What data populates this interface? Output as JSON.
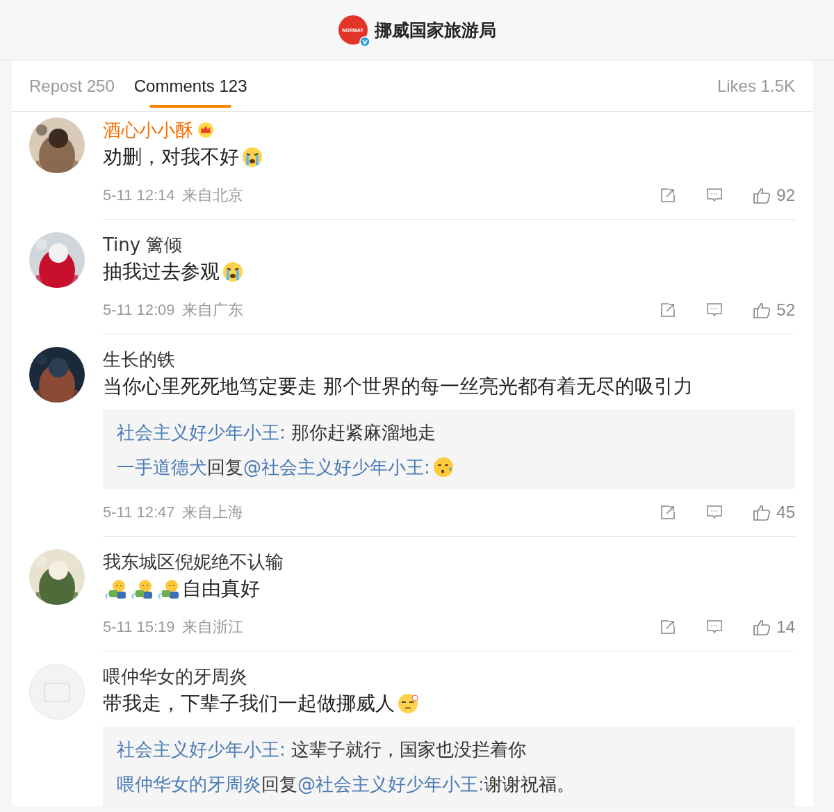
{
  "header": {
    "logo_text": "NORWAY",
    "title": "挪威国家旅游局",
    "verified": true
  },
  "tabs": [
    {
      "label": "Repost 250",
      "selected": false
    },
    {
      "label": "Comments 123",
      "selected": true
    },
    {
      "label": "Likes 1.5K",
      "selected": false
    }
  ],
  "comments": [
    {
      "kind": "picture",
      "name": "酒心小小酥",
      "vip": true,
      "content": [
        {
          "kind": "text",
          "text": "劝删，对我不好"
        },
        {
          "kind": "cry"
        }
      ],
      "time": "5-11 12:14",
      "source": "来自北京",
      "likes": "92"
    },
    {
      "kind": "picture",
      "name": "Tiny 篱倾",
      "vip": false,
      "content": [
        {
          "kind": "text",
          "text": "抽我过去参观"
        },
        {
          "kind": "cry"
        }
      ],
      "time": "5-11 12:09",
      "source": "来自广东",
      "likes": "52"
    },
    {
      "kind": "picture",
      "name": "生长的铁",
      "vip": false,
      "content": [
        {
          "kind": "text",
          "text": "当你心里死死地笃定要走 那个世界的每一丝亮光都有着无尽的吸引力"
        }
      ],
      "replies": [
        {
          "author": "社会主义好少年小王:",
          "content": [
            {
              "kind": "text",
              "text": " 那你赶紧麻溜地走"
            }
          ]
        },
        {
          "author": "一手道德犬",
          "reply_word": "回复",
          "mention": "@社会主义好少年小王:",
          "content": [
            {
              "kind": "sweat"
            }
          ]
        }
      ],
      "time": "5-11 12:47",
      "source": "来自上海",
      "likes": "45"
    },
    {
      "kind": "picture",
      "name": "我东城区倪妮绝不认输",
      "vip": false,
      "content": [
        {
          "kind": "watering"
        },
        {
          "kind": "watering"
        },
        {
          "kind": "watering"
        },
        {
          "kind": "text",
          "text": "自由真好"
        }
      ],
      "time": "5-11 15:19",
      "source": "来自浙江",
      "likes": "14"
    },
    {
      "kind": "default",
      "name": "喂仲华女的牙周炎",
      "vip": false,
      "content": [
        {
          "kind": "text",
          "text": "带我走，下辈子我们一起做挪威人"
        },
        {
          "kind": "smug"
        }
      ],
      "replies": [
        {
          "author": "社会主义好少年小王:",
          "content": [
            {
              "kind": "text",
              "text": " 这辈子就行，国家也没拦着你"
            }
          ]
        },
        {
          "author": "喂仲华女的牙周炎",
          "reply_word": "回复",
          "mention": "@社会主义好少年小王:",
          "content": [
            {
              "kind": "text",
              "text": "谢谢祝福。"
            }
          ]
        }
      ]
    }
  ]
}
